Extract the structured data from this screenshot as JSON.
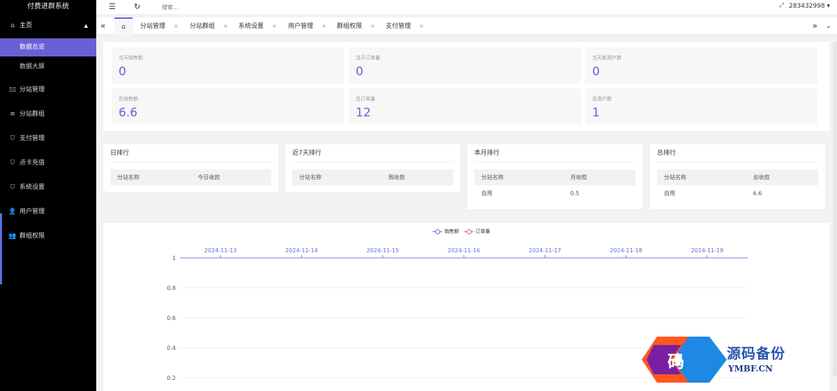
{
  "app": {
    "title": "付费进群系统"
  },
  "sidebar": {
    "home": {
      "label": "主页",
      "icon": "home-icon"
    },
    "sub_items": [
      {
        "label": "数据总览",
        "active": true
      },
      {
        "label": "数据大屏",
        "active": false
      }
    ],
    "items": [
      {
        "label": "分站管理",
        "icon": "columns-icon"
      },
      {
        "label": "分站群组",
        "icon": "sliders-icon"
      },
      {
        "label": "支付管理",
        "icon": "shield-check-icon"
      },
      {
        "label": "点卡充值",
        "icon": "shield-check-icon"
      },
      {
        "label": "系统设置",
        "icon": "shield-check-icon"
      },
      {
        "label": "用户管理",
        "icon": "user-icon"
      },
      {
        "label": "群组权限",
        "icon": "users-icon"
      }
    ]
  },
  "topbar": {
    "search_placeholder": "搜索...",
    "username": "283432998"
  },
  "tabs": [
    "分站管理",
    "分站群组",
    "系统设置",
    "用户管理",
    "群组权限",
    "支付管理"
  ],
  "stats": [
    {
      "label": "当天销售额",
      "value": "0"
    },
    {
      "label": "当天订单量",
      "value": "0"
    },
    {
      "label": "当天新用户数",
      "value": "0"
    },
    {
      "label": "总销售额",
      "value": "6.6"
    },
    {
      "label": "总订单量",
      "value": "12"
    },
    {
      "label": "总用户数",
      "value": "1"
    }
  ],
  "rankings": [
    {
      "title": "日排行",
      "col1": "分站名称",
      "col2": "今日收款",
      "rows": []
    },
    {
      "title": "近7天排行",
      "col1": "分站名称",
      "col2": "周收款",
      "rows": []
    },
    {
      "title": "本月排行",
      "col1": "分站名称",
      "col2": "月收款",
      "rows": [
        {
          "name": "自用",
          "amount": "0.5"
        }
      ]
    },
    {
      "title": "总排行",
      "col1": "分站名称",
      "col2": "总收款",
      "rows": [
        {
          "name": "自用",
          "amount": "6.6"
        }
      ]
    }
  ],
  "chart_data": {
    "type": "line",
    "x": [
      "2024-11-13",
      "2024-11-14",
      "2024-11-15",
      "2024-11-16",
      "2024-11-17",
      "2024-11-18",
      "2024-11-19"
    ],
    "series": [
      {
        "name": "销售额",
        "values": [
          0,
          0,
          0,
          0,
          0,
          0,
          0
        ],
        "color": "#5a6dd8"
      },
      {
        "name": "订单量",
        "values": [
          0,
          0,
          0,
          0,
          0,
          0,
          0
        ],
        "color": "#e0606a"
      }
    ],
    "y_ticks": [
      "1",
      "0.8",
      "0.6",
      "0.4",
      "0.2"
    ],
    "ylim": [
      0,
      1
    ],
    "x_axis_position": "top",
    "legend_position": "top-center",
    "grid": true
  },
  "watermark": {
    "text_cn": "源码备份",
    "text_en": "YMBF.CN",
    "logo_char": "码"
  }
}
